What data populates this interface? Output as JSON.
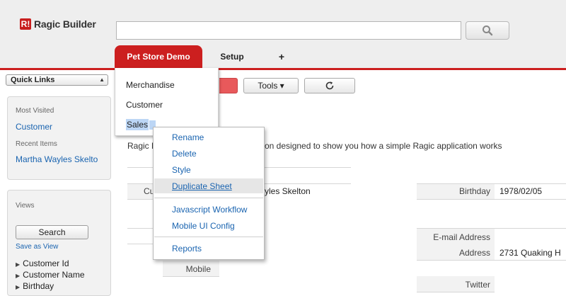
{
  "header": {
    "logo_mark": "R!",
    "logo_text": "Ragic Builder",
    "search_value": "",
    "tabs": [
      {
        "label": "Pet Store Demo"
      },
      {
        "label": "Setup"
      },
      {
        "label": "+"
      }
    ]
  },
  "sidebar": {
    "quick_links_label": "Quick Links",
    "most_visited_label": "Most Visited",
    "most_visited_link": "Customer",
    "recent_items_label": "Recent Items",
    "recent_item_link": "Martha Wayles Skelto",
    "views_label": "Views",
    "search_button": "Search",
    "save_as_view": "Save as View",
    "fields": [
      "Customer Id",
      "Customer Name",
      "Birthday"
    ]
  },
  "toolbar": {
    "tools_label": "Tools ▾"
  },
  "main": {
    "desc_start": "Ragic F",
    "desc_end": "on designed to show you how a simple Ragic application works",
    "partial_label_cu": "Cu",
    "name_value_partial": "yles Skelton",
    "birthday_label": "Birthday",
    "birthday_value": "1978/02/05",
    "email_label": "E-mail Address",
    "address_label": "Address",
    "address_value": "2731 Quaking H",
    "mobile_label": "Mobile",
    "twitter_label": "Twitter"
  },
  "tab_menu": {
    "items": [
      "Merchandise",
      "Customer",
      "Sales"
    ]
  },
  "context_menu": {
    "items": [
      "Rename",
      "Delete",
      "Style",
      "Duplicate Sheet",
      "Javascript Workflow",
      "Mobile UI Config",
      "Reports"
    ]
  },
  "colors": {
    "accent": "#cc1f1f",
    "link": "#1a64b0"
  }
}
